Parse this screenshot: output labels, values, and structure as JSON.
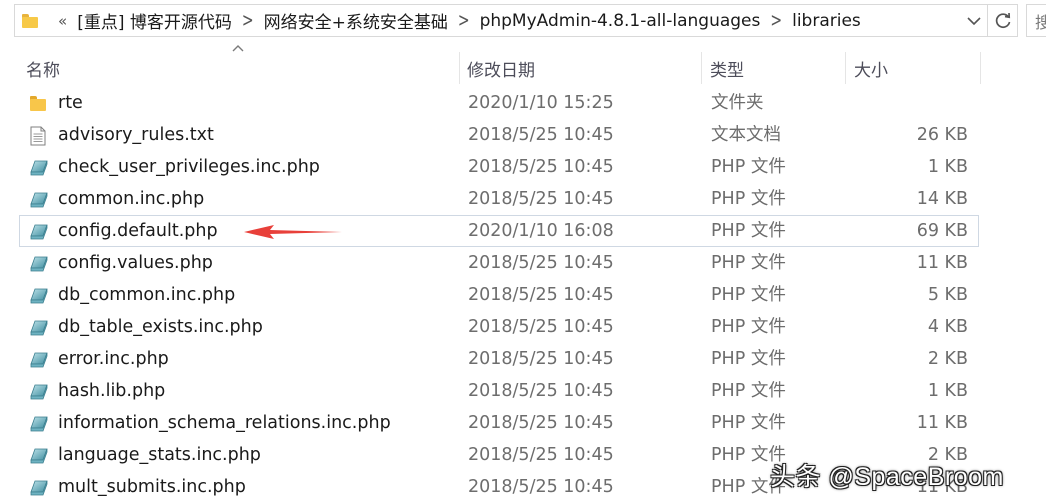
{
  "address_bar": {
    "overflow": "«",
    "crumbs": [
      "[重点] 博客开源代码",
      "网络安全+系统安全基础",
      "phpMyAdmin-4.8.1-all-languages",
      "libraries"
    ],
    "search_glyph": "搜"
  },
  "columns": {
    "name": "名称",
    "date": "修改日期",
    "type": "类型",
    "size": "大小"
  },
  "files": [
    {
      "name": "rte",
      "date": "2020/1/10 15:25",
      "type": "文件夹",
      "size": "",
      "icon": "folder-icon"
    },
    {
      "name": "advisory_rules.txt",
      "date": "2018/5/25 10:45",
      "type": "文本文档",
      "size": "26 KB",
      "icon": "text-file-icon"
    },
    {
      "name": "check_user_privileges.inc.php",
      "date": "2018/5/25 10:45",
      "type": "PHP 文件",
      "size": "1 KB",
      "icon": "php-file-icon"
    },
    {
      "name": "common.inc.php",
      "date": "2018/5/25 10:45",
      "type": "PHP 文件",
      "size": "14 KB",
      "icon": "php-file-icon"
    },
    {
      "name": "config.default.php",
      "date": "2020/1/10 16:08",
      "type": "PHP 文件",
      "size": "69 KB",
      "icon": "php-file-icon",
      "selected": true
    },
    {
      "name": "config.values.php",
      "date": "2018/5/25 10:45",
      "type": "PHP 文件",
      "size": "11 KB",
      "icon": "php-file-icon"
    },
    {
      "name": "db_common.inc.php",
      "date": "2018/5/25 10:45",
      "type": "PHP 文件",
      "size": "5 KB",
      "icon": "php-file-icon"
    },
    {
      "name": "db_table_exists.inc.php",
      "date": "2018/5/25 10:45",
      "type": "PHP 文件",
      "size": "4 KB",
      "icon": "php-file-icon"
    },
    {
      "name": "error.inc.php",
      "date": "2018/5/25 10:45",
      "type": "PHP 文件",
      "size": "2 KB",
      "icon": "php-file-icon"
    },
    {
      "name": "hash.lib.php",
      "date": "2018/5/25 10:45",
      "type": "PHP 文件",
      "size": "1 KB",
      "icon": "php-file-icon"
    },
    {
      "name": "information_schema_relations.inc.php",
      "date": "2018/5/25 10:45",
      "type": "PHP 文件",
      "size": "11 KB",
      "icon": "php-file-icon"
    },
    {
      "name": "language_stats.inc.php",
      "date": "2018/5/25 10:45",
      "type": "PHP 文件",
      "size": "2 KB",
      "icon": "php-file-icon"
    },
    {
      "name": "mult_submits.inc.php",
      "date": "2018/5/25 10:45",
      "type": "PHP 文件",
      "size": "11 KB",
      "icon": "php-file-icon"
    }
  ],
  "annotation": {
    "color": "#e8403a"
  },
  "watermark": "头条 @SpaceBroom",
  "colors": {
    "folder": "#f8c64a",
    "php_icon": "#5aa8b8",
    "selection_border": "#cfd8e3"
  }
}
